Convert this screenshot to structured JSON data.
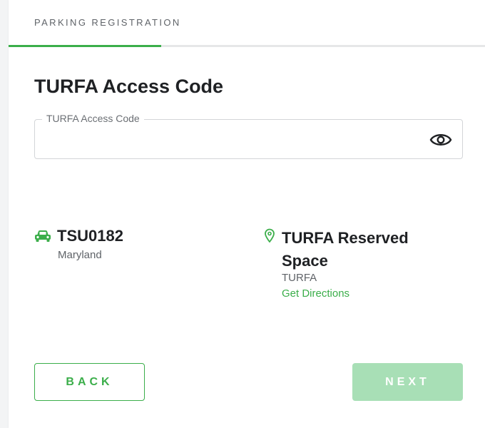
{
  "header": {
    "label": "PARKING REGISTRATION",
    "progress_fraction": 0.32
  },
  "form": {
    "title": "TURFA Access Code",
    "field_label": "TURFA Access Code",
    "field_value": "",
    "toggle_icon": "eye-icon"
  },
  "vehicle": {
    "icon": "car-icon",
    "plate": "TSU0182",
    "state": "Maryland"
  },
  "location": {
    "icon": "map-pin-icon",
    "name": "TURFA Reserved Space",
    "sub": "TURFA",
    "directions_label": "Get Directions"
  },
  "actions": {
    "back_label": "BACK",
    "next_label": "NEXT"
  },
  "colors": {
    "accent": "#3bae4a",
    "next_disabled": "#a8dfb6",
    "text": "#1f2124",
    "muted": "#5f6368"
  }
}
